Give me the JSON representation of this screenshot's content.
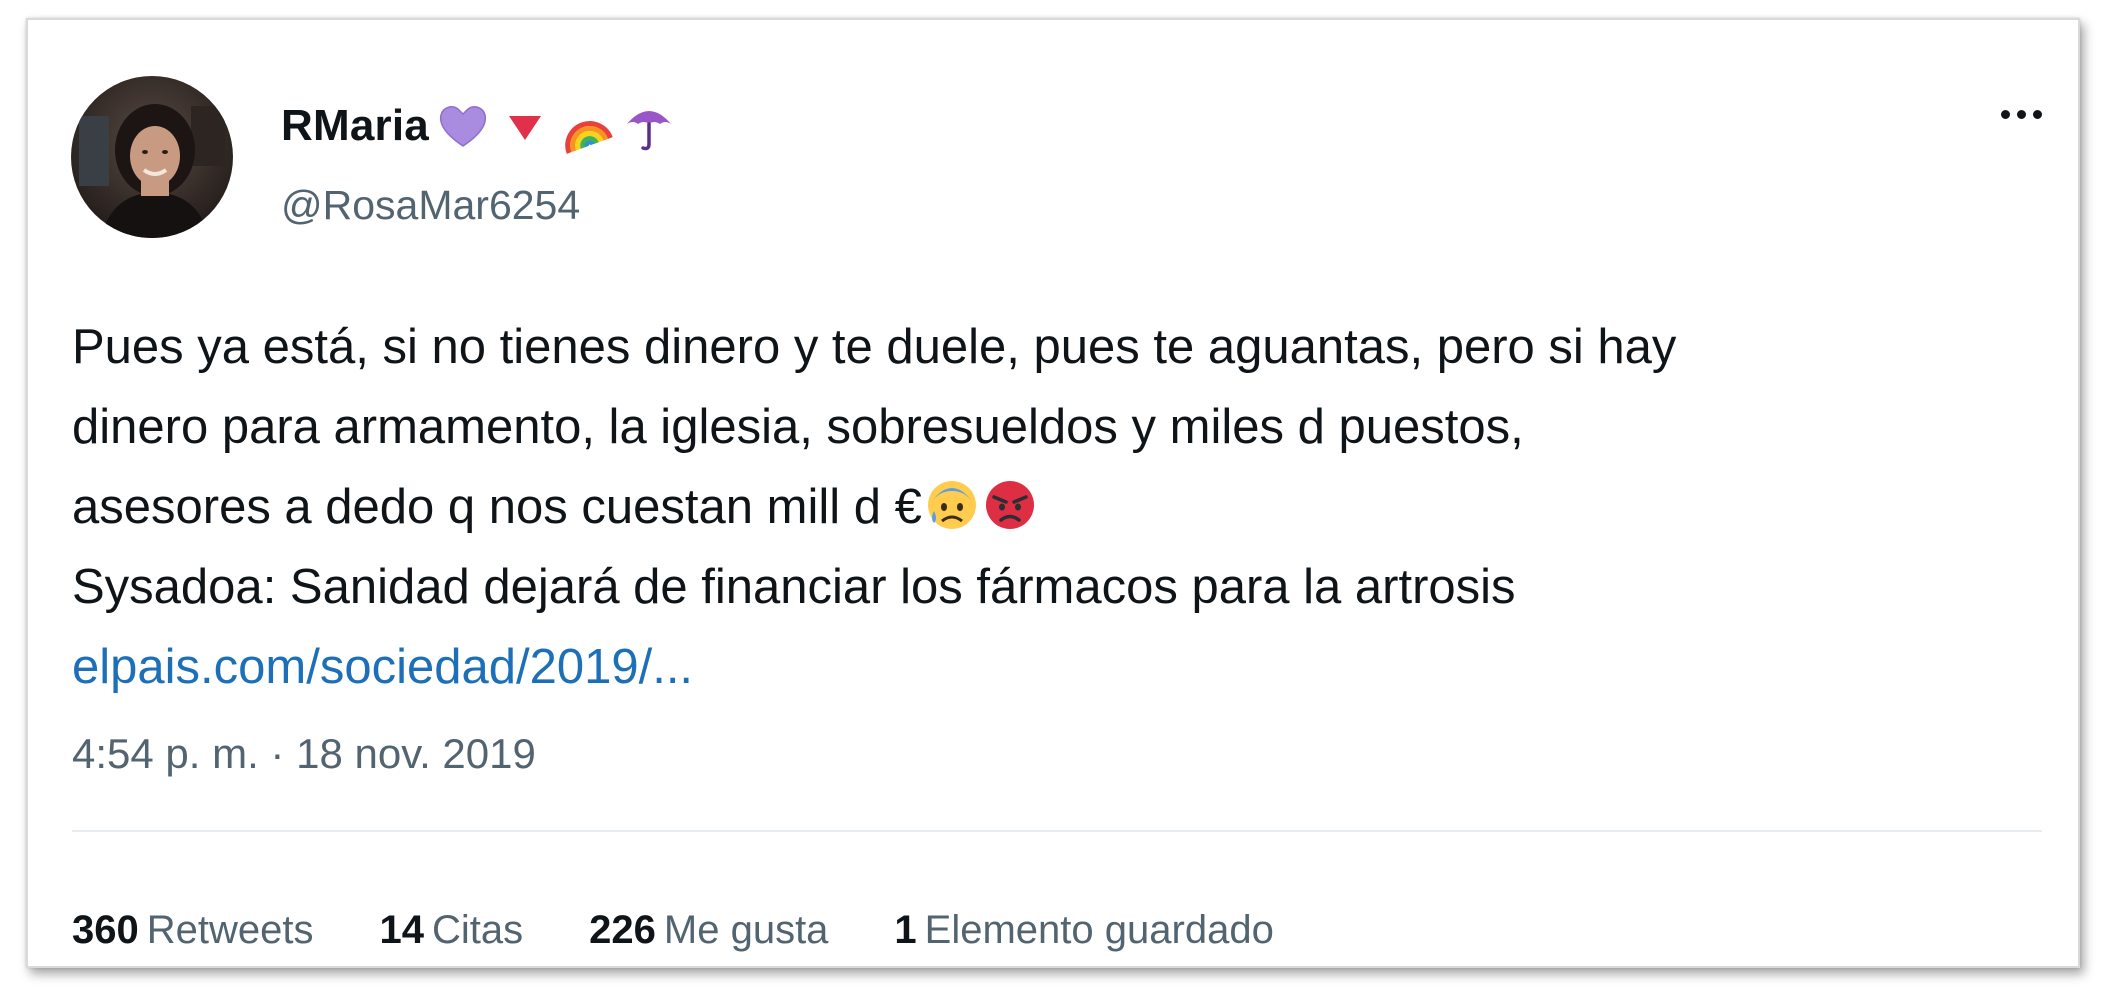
{
  "tweet": {
    "author": {
      "display_name": "RMaria",
      "name_emojis": [
        "purple-heart-icon",
        "red-triangle-down-icon",
        "rainbow-icon",
        "umbrella-icon"
      ],
      "handle": "@RosaMar6254"
    },
    "text_lines": [
      "Pues ya está, si no tienes dinero y te duele, pues te aguantas, pero si hay",
      "dinero para armamento, la iglesia, sobresueldos y miles d puestos,",
      "asesores a dedo q nos cuestan mill d €",
      "Sysadoa: Sanidad dejará de financiar los fármacos para la artrosis"
    ],
    "inline_emojis": [
      "anxious-face-with-sweat-icon",
      "angry-face-icon"
    ],
    "link": "elpais.com/sociedad/2019/...",
    "timestamp": "4:54 p. m. · 18 nov. 2019",
    "stats": {
      "retweets": {
        "count": "360",
        "label": "Retweets"
      },
      "quotes": {
        "count": "14",
        "label": "Citas"
      },
      "likes": {
        "count": "226",
        "label": "Me gusta"
      },
      "bookmarks": {
        "count": "1",
        "label": "Elemento guardado"
      }
    },
    "colors": {
      "text": "#0f1419",
      "secondary": "#536471",
      "link": "#1d70b8"
    }
  }
}
